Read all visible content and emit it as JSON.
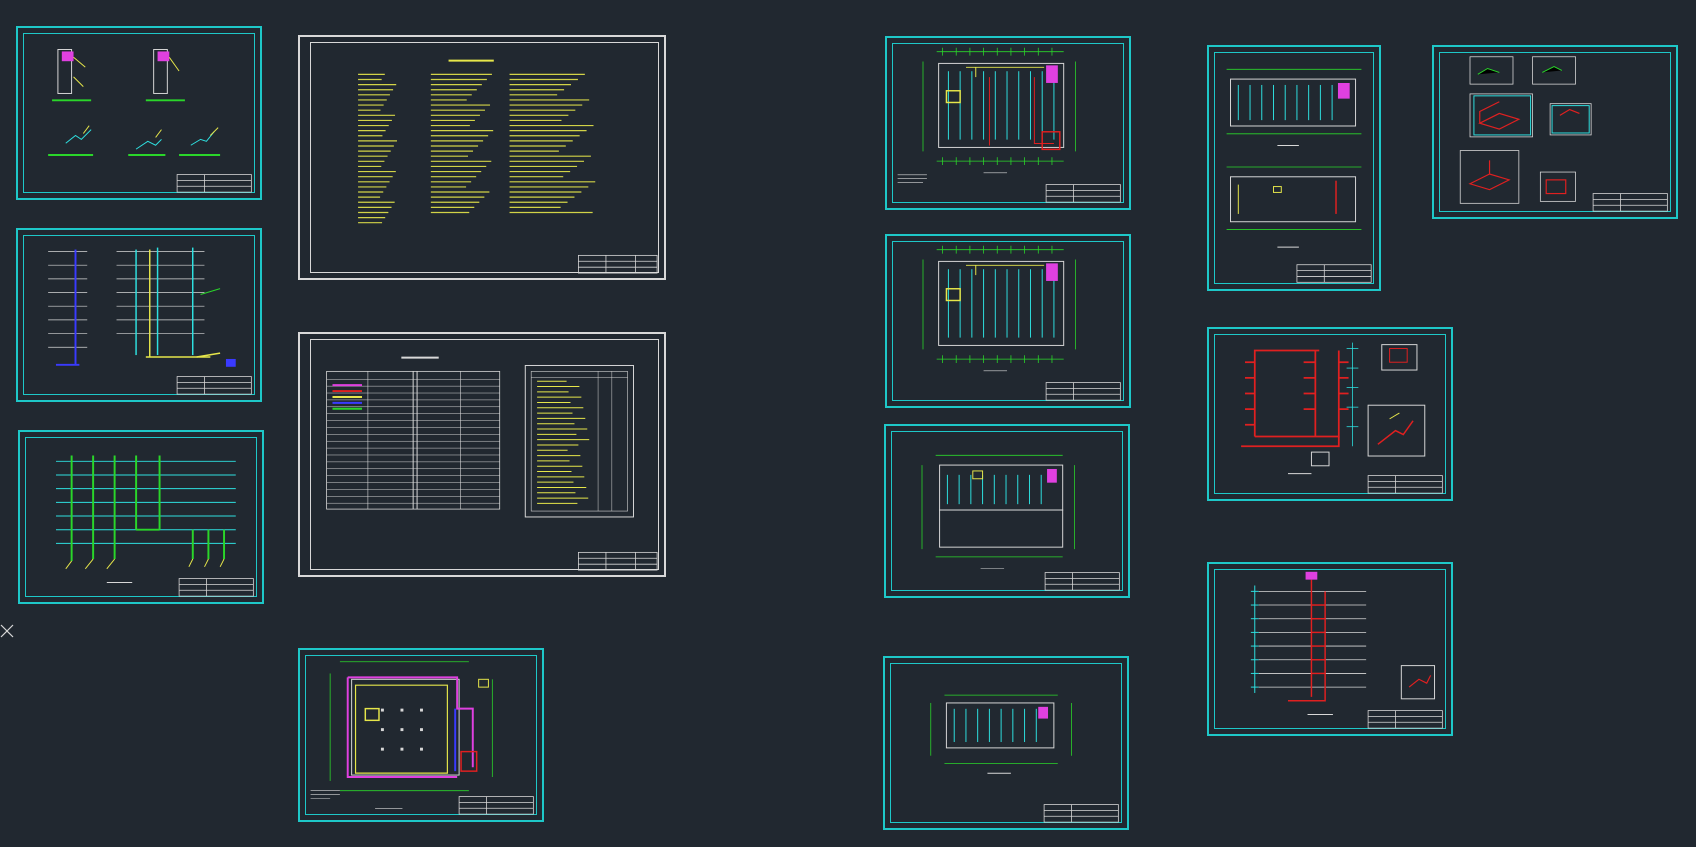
{
  "app": {
    "viewport": "cad-model-space",
    "background": "#212830"
  },
  "colors": {
    "frame": "#1ec8c8",
    "white": "#d8d8d8",
    "yellow": "#e6e64a",
    "green": "#2ad62a",
    "red": "#e02020",
    "magenta": "#e040e0",
    "blue": "#3a3aff",
    "cyan": "#2ee0e0"
  },
  "icons": {
    "cursor": "crosshair-cursor-icon"
  },
  "sheets": [
    {
      "id": "s1",
      "kind": "riser-details"
    },
    {
      "id": "s2",
      "kind": "riser-diagram"
    },
    {
      "id": "s3",
      "kind": "pipe-system-diagram"
    },
    {
      "id": "s4",
      "kind": "design-notes"
    },
    {
      "id": "s5",
      "kind": "legend-and-equipment-table"
    },
    {
      "id": "s6",
      "kind": "basement-floor-plan"
    },
    {
      "id": "s7",
      "kind": "floor-plan-1"
    },
    {
      "id": "s8",
      "kind": "floor-plan-2"
    },
    {
      "id": "s9",
      "kind": "floor-plan-3"
    },
    {
      "id": "s10",
      "kind": "floor-plan-4"
    },
    {
      "id": "s11",
      "kind": "roof-floor-plans"
    },
    {
      "id": "s12",
      "kind": "axonometric-details"
    },
    {
      "id": "s13",
      "kind": "sprinkler-system"
    },
    {
      "id": "s14",
      "kind": "drainage-system"
    }
  ]
}
